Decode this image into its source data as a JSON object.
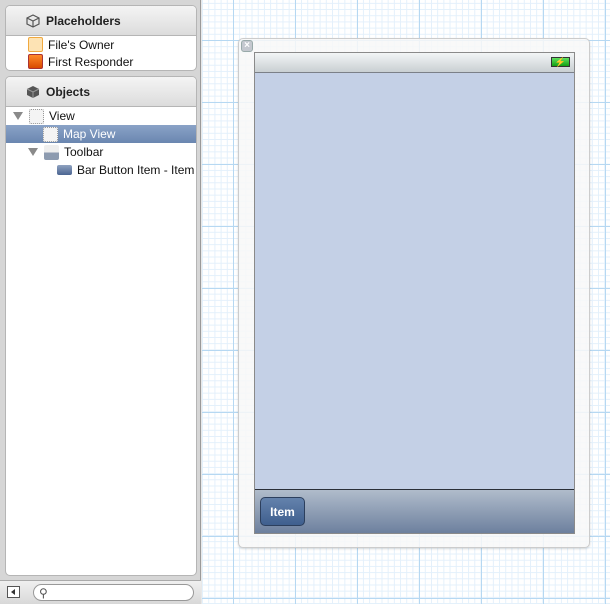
{
  "placeholders": {
    "title": "Placeholders",
    "items": [
      {
        "label": "File's Owner",
        "icon": "cube-outline-icon"
      },
      {
        "label": "First Responder",
        "icon": "first-responder-cube-icon"
      }
    ]
  },
  "objects": {
    "title": "Objects",
    "items": [
      {
        "label": "View",
        "level": 0,
        "expanded": true,
        "selected": false,
        "icon": "view-icon"
      },
      {
        "label": "Map View",
        "level": 1,
        "expanded": null,
        "selected": true,
        "icon": "view-icon"
      },
      {
        "label": "Toolbar",
        "level": 1,
        "expanded": true,
        "selected": false,
        "icon": "toolbar-icon"
      },
      {
        "label": "Bar Button Item - Item",
        "level": 2,
        "expanded": null,
        "selected": false,
        "icon": "bar-button-icon"
      }
    ]
  },
  "search": {
    "placeholder": "",
    "value": ""
  },
  "canvas": {
    "toolbar_item_label": "Item",
    "map_color": "#c4d0e6"
  }
}
